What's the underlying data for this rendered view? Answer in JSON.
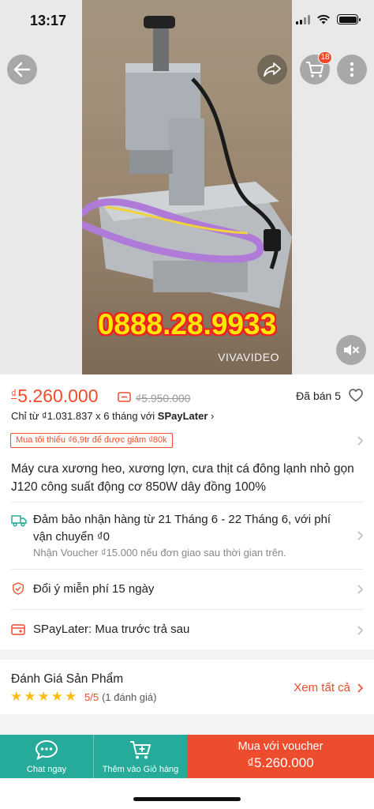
{
  "status_bar": {
    "time": "13:17"
  },
  "header": {
    "cart_count": "18"
  },
  "media": {
    "overlay_text": "0888.28.9933",
    "watermark": "VIVAVIDEO"
  },
  "product": {
    "currency": "₫",
    "price": "5.260.000",
    "old_price": "₫5.950.000",
    "sold_label": "Đã bán 5",
    "installment_prefix": "Chỉ từ ₫1.031.837 x 6 tháng với ",
    "installment_brand": "SPayLater",
    "promo_tag": "Mua tối thiểu ₫6,9tr để được giảm ₫80k",
    "title": "Máy cưa xương heo, xương lợn, cưa thịt cá đông lạnh nhỏ gọn J120 công suất động cơ 850W dây đồng 100%"
  },
  "shipping": {
    "text": "Đảm bảo nhận hàng từ 21 Tháng 6 - 22 Tháng 6, với phí vận chuyển ₫0",
    "sub": "Nhận Voucher ₫15.000 nếu đơn giao sau thời gian trên."
  },
  "returns": {
    "text": "Đổi ý miễn phí 15 ngày"
  },
  "spaylater": {
    "text": "SPayLater: Mua trước trả sau"
  },
  "reviews": {
    "title": "Đánh Giá Sản Phẩm",
    "stars": 5,
    "score": "5/5",
    "count": "(1 đánh giá)",
    "see_all": "Xem tất cả"
  },
  "bottom_bar": {
    "chat_label": "Chat ngay",
    "cart_label": "Thêm vào Giỏ hàng",
    "buy_line1": "Mua với voucher",
    "buy_line2": "₫5.260.000"
  },
  "colors": {
    "brand": "#ee4d2d",
    "teal": "#26aa99",
    "star": "#ffbd14"
  }
}
